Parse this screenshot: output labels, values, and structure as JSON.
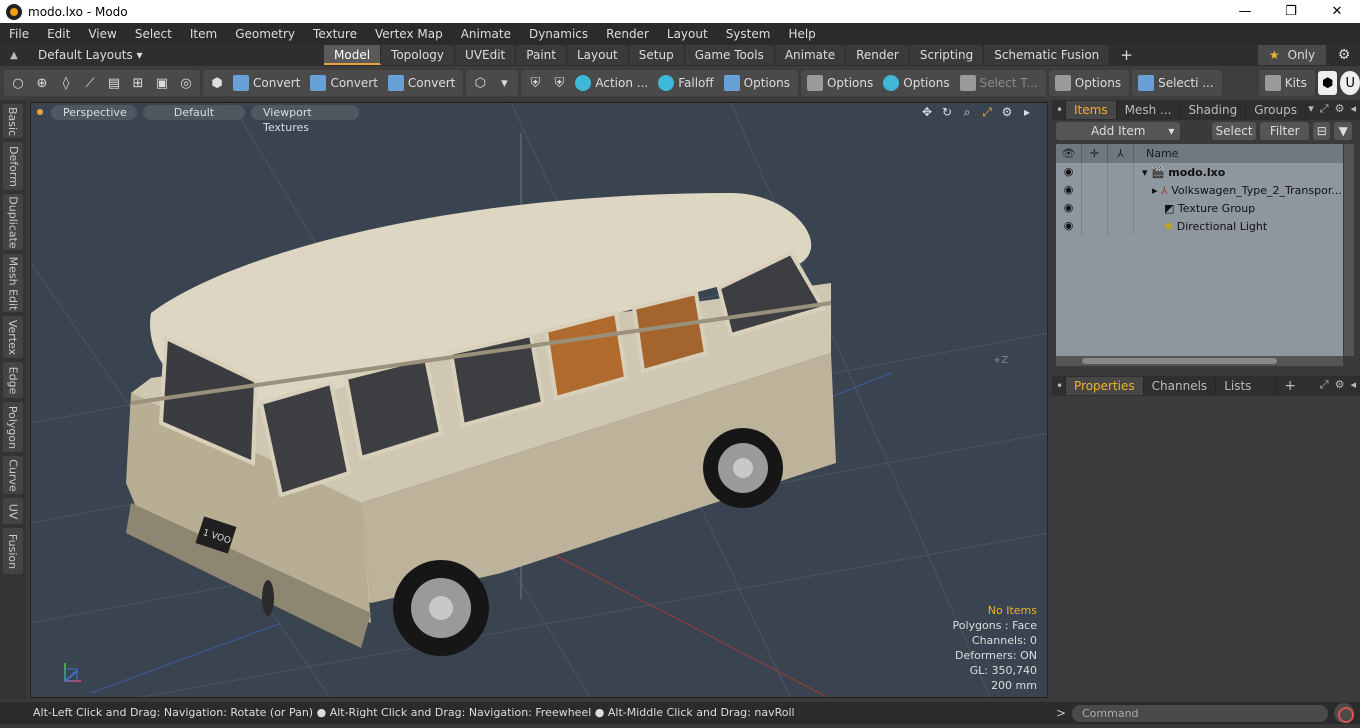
{
  "window": {
    "title": "modo.lxo - Modo",
    "min": "—",
    "max": "❐",
    "close": "✕"
  },
  "menu": [
    "File",
    "Edit",
    "View",
    "Select",
    "Item",
    "Geometry",
    "Texture",
    "Vertex Map",
    "Animate",
    "Dynamics",
    "Render",
    "Layout",
    "System",
    "Help"
  ],
  "layout_bar": {
    "layouts_label": "Default Layouts ▾",
    "tabs": [
      "Model",
      "Topology",
      "UVEdit",
      "Paint",
      "Layout",
      "Setup",
      "Game Tools",
      "Animate",
      "Render",
      "Scripting",
      "Schematic Fusion"
    ],
    "active_tab": "Model",
    "only_label": "Only"
  },
  "toolbar": {
    "convert1": "Convert",
    "convert2": "Convert",
    "convert3": "Convert",
    "action": "Action ...",
    "falloff": "Falloff",
    "options1": "Options",
    "options2": "Options",
    "options3": "Options",
    "select_t": "Select T...",
    "options4": "Options",
    "selecti": "Selecti ...",
    "kits": "Kits"
  },
  "left_tabs": [
    "Basic",
    "Deform",
    "Duplicate",
    "Mesh Edit",
    "Vertex",
    "Edge",
    "Polygon",
    "Curve",
    "UV",
    "Fusion"
  ],
  "viewport": {
    "perspective": "Perspective",
    "default": "Default",
    "textures": "Viewport Textures",
    "info": {
      "no_items": "No Items",
      "polygons": "Polygons : Face",
      "channels": "Channels: 0",
      "deformers": "Deformers: ON",
      "gl": "GL: 350,740",
      "scale": "200 mm"
    },
    "axis_label": "+Z",
    "plate": "1 VOO"
  },
  "status": {
    "text": "Alt-Left Click and Drag: Navigation: Rotate (or Pan) ● Alt-Right Click and Drag: Navigation: Freewheel ● Alt-Middle Click and Drag: navRoll",
    "command_placeholder": "Command"
  },
  "items_panel": {
    "tabs": [
      "Items",
      "Mesh ...",
      "Shading",
      "Groups"
    ],
    "active_tab": "Items",
    "add_item": "Add Item",
    "select": "Select",
    "filter": "Filter",
    "column_name": "Name",
    "rows": [
      {
        "name": "modo.lxo"
      },
      {
        "name": "Volkswagen_Type_2_Transpor..."
      },
      {
        "name": "Texture Group"
      },
      {
        "name": "Directional Light"
      }
    ]
  },
  "properties_panel": {
    "tabs": [
      "Properties",
      "Channels",
      "Lists"
    ],
    "active_tab": "Properties"
  },
  "colors": {
    "accent": "#e8a33d",
    "viewport_bg": "#3a4450",
    "list_bg": "#8e969f"
  }
}
